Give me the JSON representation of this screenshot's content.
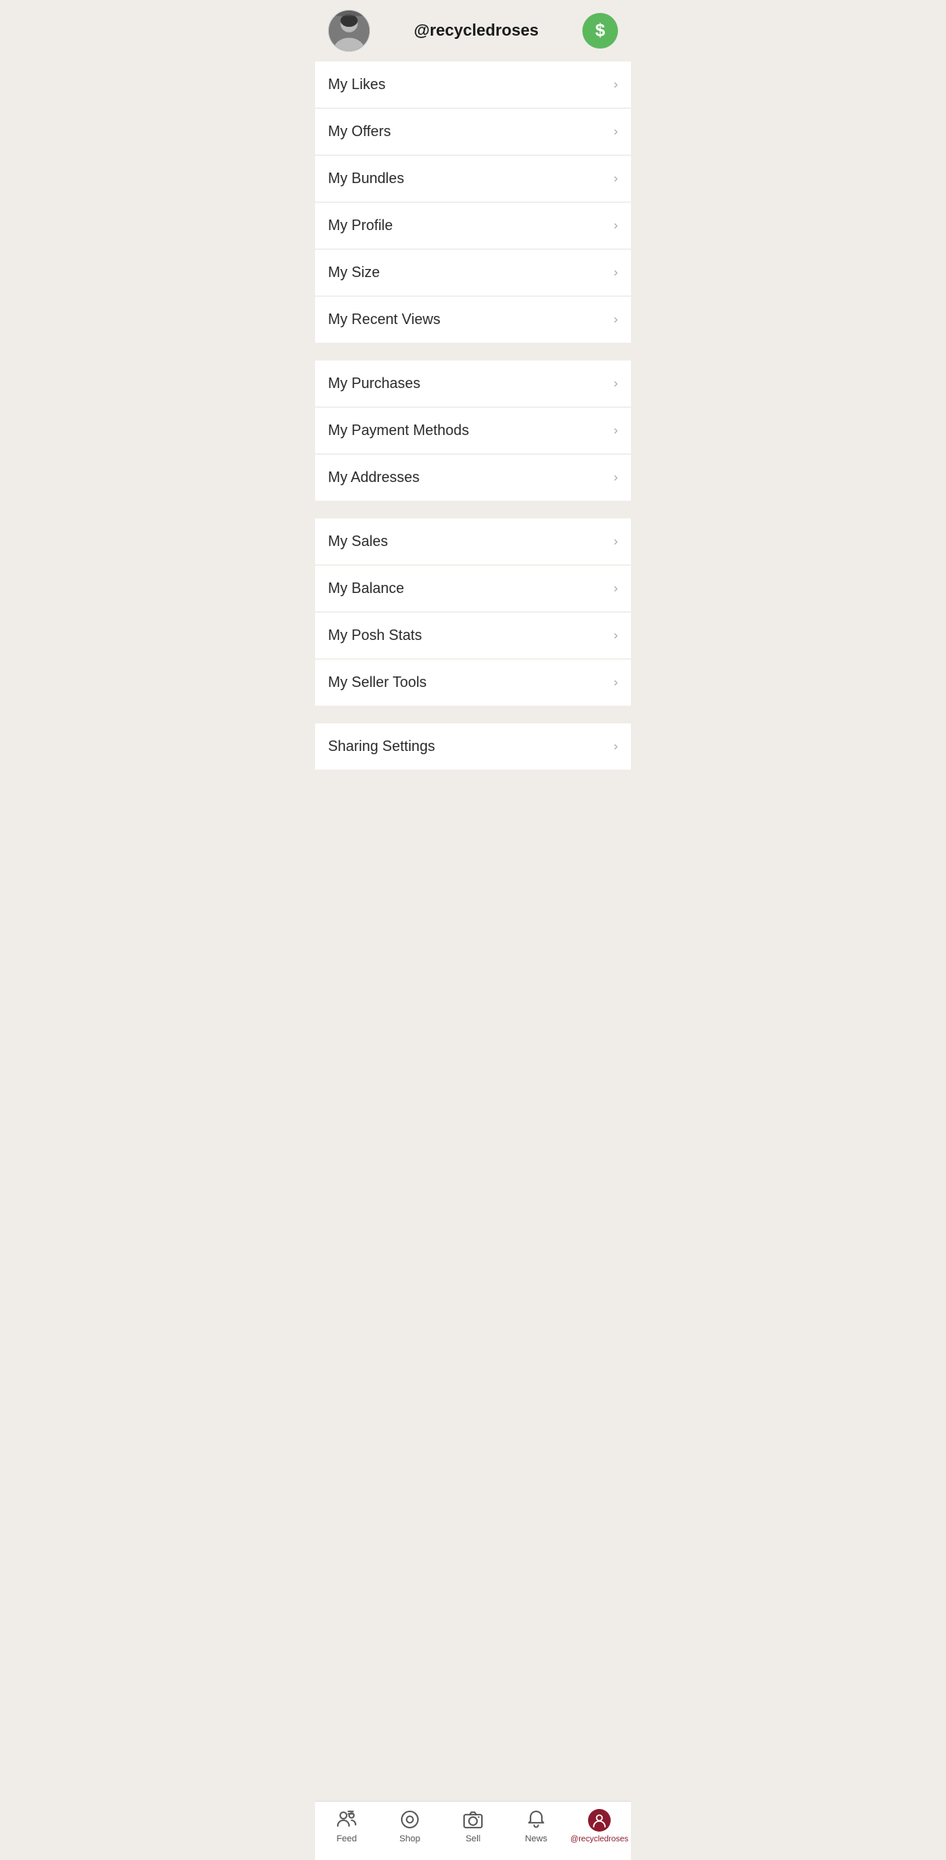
{
  "header": {
    "username": "@recycledroses",
    "avatar_alt": "Profile photo of recycledroses",
    "dollar_icon_label": "$"
  },
  "menu_sections": [
    {
      "id": "section1",
      "items": [
        {
          "id": "my-likes",
          "label": "My Likes"
        },
        {
          "id": "my-offers",
          "label": "My Offers"
        },
        {
          "id": "my-bundles",
          "label": "My Bundles"
        },
        {
          "id": "my-profile",
          "label": "My Profile"
        },
        {
          "id": "my-size",
          "label": "My Size"
        },
        {
          "id": "my-recent-views",
          "label": "My Recent Views"
        }
      ]
    },
    {
      "id": "section2",
      "items": [
        {
          "id": "my-purchases",
          "label": "My Purchases"
        },
        {
          "id": "my-payment-methods",
          "label": "My Payment Methods"
        },
        {
          "id": "my-addresses",
          "label": "My Addresses"
        }
      ]
    },
    {
      "id": "section3",
      "items": [
        {
          "id": "my-sales",
          "label": "My Sales"
        },
        {
          "id": "my-balance",
          "label": "My Balance"
        },
        {
          "id": "my-posh-stats",
          "label": "My Posh Stats"
        },
        {
          "id": "my-seller-tools",
          "label": "My Seller Tools"
        }
      ]
    },
    {
      "id": "section4",
      "items": [
        {
          "id": "sharing-settings",
          "label": "Sharing Settings"
        }
      ]
    }
  ],
  "bottom_nav": {
    "items": [
      {
        "id": "feed",
        "label": "Feed",
        "icon": "feed-icon",
        "active": false
      },
      {
        "id": "shop",
        "label": "Shop",
        "icon": "shop-icon",
        "active": false
      },
      {
        "id": "sell",
        "label": "Sell",
        "icon": "sell-icon",
        "active": false
      },
      {
        "id": "news",
        "label": "News",
        "icon": "news-icon",
        "active": false
      },
      {
        "id": "account",
        "label": "@recycledroses",
        "icon": "account-icon",
        "active": true
      }
    ]
  },
  "colors": {
    "accent": "#8b1a2e",
    "green": "#5cb85c",
    "background": "#f0ede8",
    "white": "#ffffff",
    "text_dark": "#2a2a2a",
    "text_muted": "#aaaaaa"
  }
}
